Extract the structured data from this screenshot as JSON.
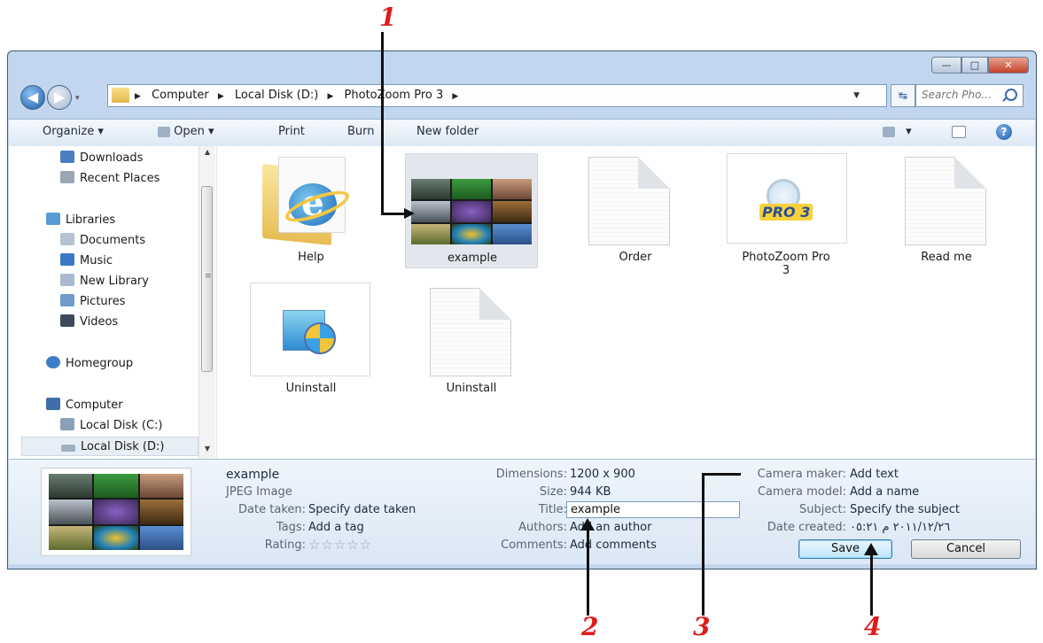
{
  "callouts": [
    "1",
    "2",
    "3",
    "4"
  ],
  "window": {
    "minimize_glyph": "—",
    "maximize_glyph": "□",
    "close_glyph": "✕"
  },
  "nav": {
    "back_glyph": "◀",
    "forward_glyph": "▶",
    "history_glyph": "▾"
  },
  "address": {
    "crumbs": [
      "Computer",
      "Local Disk (D:)",
      "PhotoZoom Pro 3"
    ],
    "separator": "▶",
    "dropdown_glyph": "▼",
    "refresh_glyph": "↹"
  },
  "search": {
    "placeholder": "Search Pho..."
  },
  "toolbar": {
    "organize": "Organize ▾",
    "open": "Open ▾",
    "print": "Print",
    "burn": "Burn",
    "new_folder": "New folder",
    "views_glyph": "▾",
    "help_glyph": "?"
  },
  "sidebar": {
    "items": [
      {
        "label": "Downloads",
        "icon": "downloads-icon",
        "color": "#4a7fc1"
      },
      {
        "label": "Recent Places",
        "icon": "recent-places-icon",
        "color": "#9aa6b4"
      },
      {
        "label": "Libraries",
        "icon": "libraries-icon",
        "color": "#5a9ad5"
      },
      {
        "label": "Documents",
        "icon": "documents-icon",
        "color": "#b5c2d2"
      },
      {
        "label": "Music",
        "icon": "music-icon",
        "color": "#3a78c8"
      },
      {
        "label": "New Library",
        "icon": "library-icon",
        "color": "#a9bad0"
      },
      {
        "label": "Pictures",
        "icon": "pictures-icon",
        "color": "#6f9cc8"
      },
      {
        "label": "Videos",
        "icon": "videos-icon",
        "color": "#3d4a5c"
      },
      {
        "label": "Homegroup",
        "icon": "homegroup-icon",
        "color": "#3d7dc8"
      },
      {
        "label": "Computer",
        "icon": "computer-icon",
        "color": "#3f6ea8"
      },
      {
        "label": "Local Disk (C:)",
        "icon": "drive-c-icon",
        "color": "#8aa0b8"
      },
      {
        "label": "Local Disk (D:)",
        "icon": "drive-d-icon",
        "color": "#9fb0c2"
      }
    ],
    "scroll_up": "▲",
    "scroll_down": "▼",
    "grip": "≡"
  },
  "files": [
    {
      "label": "Help",
      "icon": "ie-folder-icon"
    },
    {
      "label": "example",
      "icon": "image-thumbnail"
    },
    {
      "label": "Order",
      "icon": "text-document-icon"
    },
    {
      "label": "PhotoZoom Pro\n3",
      "icon": "photozoom-icon"
    },
    {
      "label": "Read me",
      "icon": "text-document-icon"
    },
    {
      "label": "Uninstall",
      "icon": "installer-icon"
    },
    {
      "label": "Uninstall",
      "icon": "text-document-icon"
    }
  ],
  "photozoom_badge": "PRO 3",
  "details": {
    "name": "example",
    "type": "JPEG Image",
    "date_taken_label": "Date taken:",
    "date_taken": "Specify date taken",
    "tags_label": "Tags:",
    "tags": "Add a tag",
    "rating_label": "Rating:",
    "rating_stars": "☆☆☆☆☆",
    "dimensions_label": "Dimensions:",
    "dimensions": "1200 x 900",
    "size_label": "Size:",
    "size": "944 KB",
    "title_label": "Title:",
    "title": "example",
    "authors_label": "Authors:",
    "authors": "Add an author",
    "comments_label": "Comments:",
    "comments": "Add comments",
    "camera_maker_label": "Camera maker:",
    "camera_maker": "Add text",
    "camera_model_label": "Camera model:",
    "camera_model": "Add a name",
    "subject_label": "Subject:",
    "subject": "Specify the subject",
    "date_created_label": "Date created:",
    "date_created": "٢٠١١/١٢/٢٦ م ٠٥:٢١",
    "save": "Save",
    "cancel": "Cancel"
  },
  "colors": {
    "callout": "#e01b1b",
    "accent": "#3c7fb1"
  }
}
